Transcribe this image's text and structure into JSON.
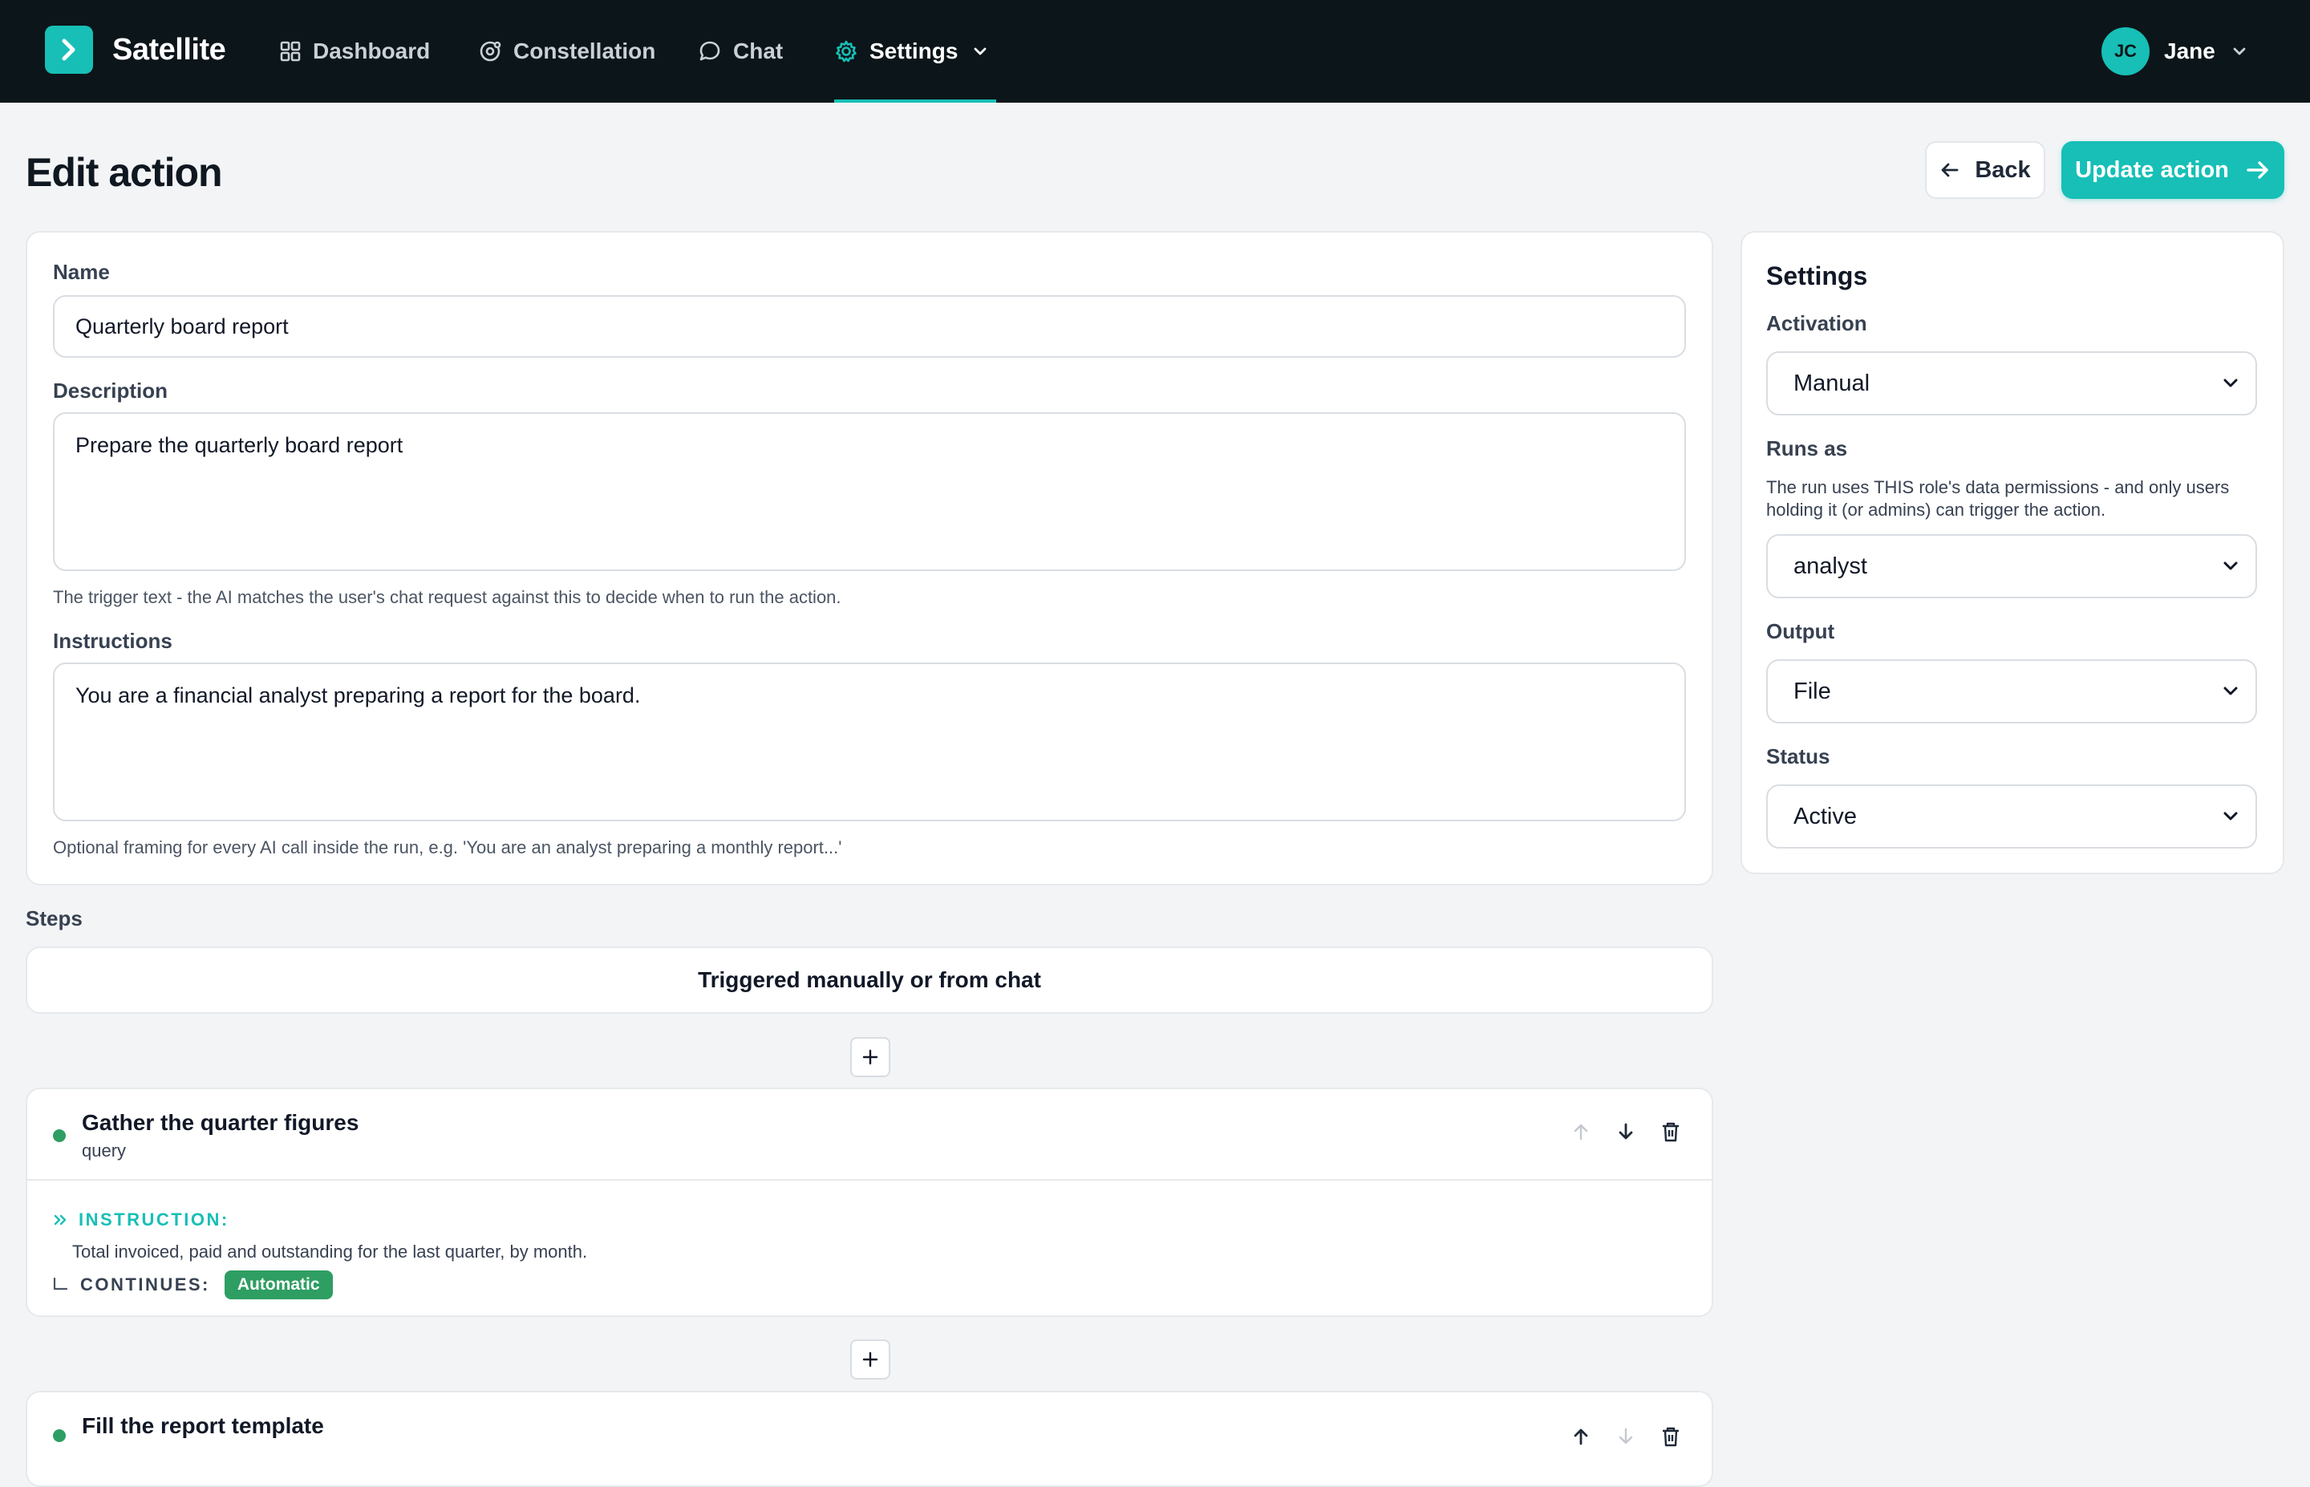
{
  "app": {
    "name": "Satellite"
  },
  "nav": {
    "items": [
      {
        "label": "Dashboard",
        "icon": "grid-icon"
      },
      {
        "label": "Constellation",
        "icon": "orbit-icon"
      },
      {
        "label": "Chat",
        "icon": "chat-bubble-icon"
      },
      {
        "label": "Settings",
        "icon": "gear-icon",
        "active": true
      }
    ],
    "user": {
      "initials": "JC",
      "name": "Jane"
    }
  },
  "header": {
    "title": "Edit action",
    "back_label": "Back",
    "update_label": "Update action"
  },
  "form": {
    "name_label": "Name",
    "name_value": "Quarterly board report",
    "description_label": "Description",
    "description_value": "Prepare the quarterly board report",
    "description_hint": "The trigger text - the AI matches the user's chat request against this to decide when to run the action.",
    "instructions_label": "Instructions",
    "instructions_value": "You are a financial analyst preparing a report for the board.",
    "instructions_hint": "Optional framing for every AI call inside the run, e.g. 'You are an analyst preparing a monthly report...'"
  },
  "settings": {
    "title": "Settings",
    "activation_label": "Activation",
    "activation_value": "Manual",
    "runs_as_label": "Runs as",
    "runs_as_desc": "The run uses THIS role's data permissions - and only users holding it (or admins) can trigger the action.",
    "runs_as_value": "analyst",
    "output_label": "Output",
    "output_value": "File",
    "status_label": "Status",
    "status_value": "Active"
  },
  "steps": {
    "label": "Steps",
    "trigger": "Triggered manually or from chat",
    "items": [
      {
        "title": "Gather the quarter figures",
        "type": "query",
        "instruction_label": "INSTRUCTION:",
        "instruction": "Total invoiced, paid and outstanding for the last quarter, by month.",
        "continues_label": "CONTINUES:",
        "continues_value": "Automatic"
      },
      {
        "title": "Fill the report template"
      }
    ]
  },
  "colors": {
    "accent": "#17bfb6",
    "nav_bg": "#0c1519",
    "success": "#2e9e63",
    "page_bg": "#f2f4f6"
  }
}
